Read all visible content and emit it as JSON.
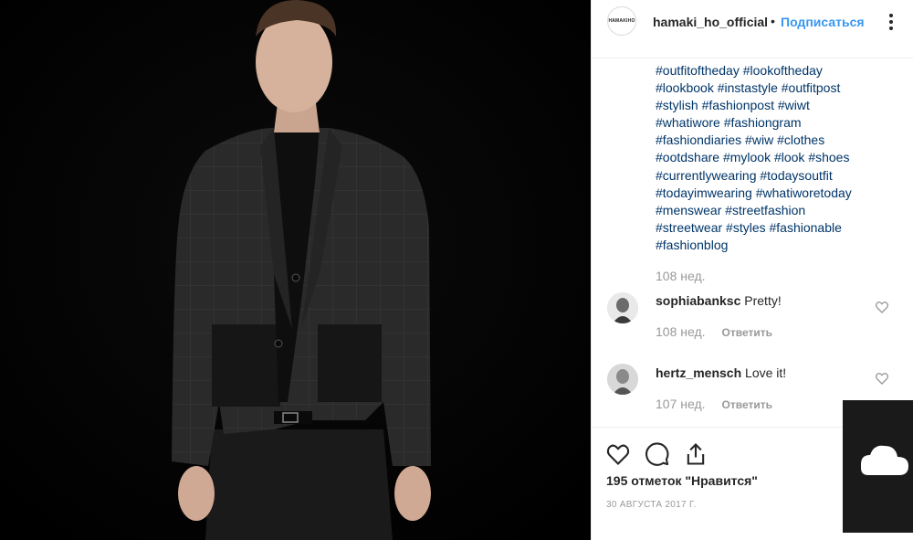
{
  "post": {
    "username": "hamaki_ho_official",
    "avatar_text": "HAMAKIHO",
    "separator": "•",
    "follow_label": "Подписаться",
    "caption_hashtags": [
      "#outfitoftheday #lookoftheday",
      "#lookbook #instastyle #outfitpost",
      "#stylish #fashionpost #wiwt",
      "#whatiwore #fashiongram",
      "#fashiondiaries #wiw #clothes",
      "#ootdshare #mylook #look #shoes",
      "#currentlywearing #todaysoutfit",
      "#todayimwearing #whatiworetoday",
      "#menswear #streetfashion",
      "#streetwear #styles #fashionable",
      "#fashionblog"
    ],
    "caption_time": "108 нед."
  },
  "comments": [
    {
      "username": "sophiabanksc",
      "text": "Pretty!",
      "time": "108 нед.",
      "reply_label": "Ответить"
    },
    {
      "username": "hertz_mensch",
      "text": "Love it!",
      "time": "107 нед.",
      "reply_label": "Ответить"
    }
  ],
  "actions": {
    "likes": "195 отметок \"Нравится\"",
    "date": "30 АВГУСТА 2017 Г."
  },
  "icons": {
    "like": "heart-icon",
    "comment": "comment-icon",
    "share": "share-icon",
    "more": "more-dots-icon",
    "overlay": "cloud-icon"
  },
  "colors": {
    "link": "#003569",
    "follow": "#3897f0",
    "muted": "#999999",
    "border": "#efefef"
  }
}
